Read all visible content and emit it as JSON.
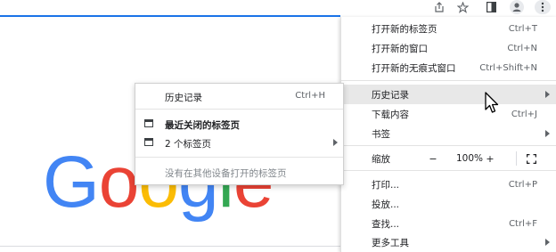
{
  "toolbar": {
    "icons": [
      "share-icon",
      "star-icon",
      "side-panel-icon",
      "profile-icon",
      "more-vert-icon"
    ]
  },
  "logo": {
    "letters": [
      {
        "ch": "G",
        "color": "#4285f4"
      },
      {
        "ch": "o",
        "color": "#ea4335"
      },
      {
        "ch": "o",
        "color": "#fbbc05"
      },
      {
        "ch": "g",
        "color": "#4285f4"
      },
      {
        "ch": "l",
        "color": "#34a853"
      },
      {
        "ch": "e",
        "color": "#ea4335"
      }
    ]
  },
  "main_menu": {
    "new_tab": {
      "label": "打开新的标签页",
      "shortcut": "Ctrl+T"
    },
    "new_window": {
      "label": "打开新的窗口",
      "shortcut": "Ctrl+N"
    },
    "new_incognito": {
      "label": "打开新的无痕式窗口",
      "shortcut": "Ctrl+Shift+N"
    },
    "history": {
      "label": "历史记录"
    },
    "downloads": {
      "label": "下载内容",
      "shortcut": "Ctrl+J"
    },
    "bookmarks": {
      "label": "书签"
    },
    "zoom": {
      "label": "缩放",
      "minus": "−",
      "value": "100%",
      "plus": "+"
    },
    "print": {
      "label": "打印...",
      "shortcut": "Ctrl+P"
    },
    "cast": {
      "label": "投放..."
    },
    "find": {
      "label": "查找...",
      "shortcut": "Ctrl+F"
    },
    "more_tools": {
      "label": "更多工具"
    }
  },
  "history_submenu": {
    "history": {
      "label": "历史记录",
      "shortcut": "Ctrl+H"
    },
    "recently_closed": {
      "label": "最近关闭的标签页"
    },
    "tabs_group": {
      "label": "2 个标签页"
    },
    "other_devices": {
      "label": "没有在其他设备打开的标签页"
    }
  },
  "colors": {
    "accent": "#1a73e8",
    "highlight": "#e8e8e8"
  }
}
